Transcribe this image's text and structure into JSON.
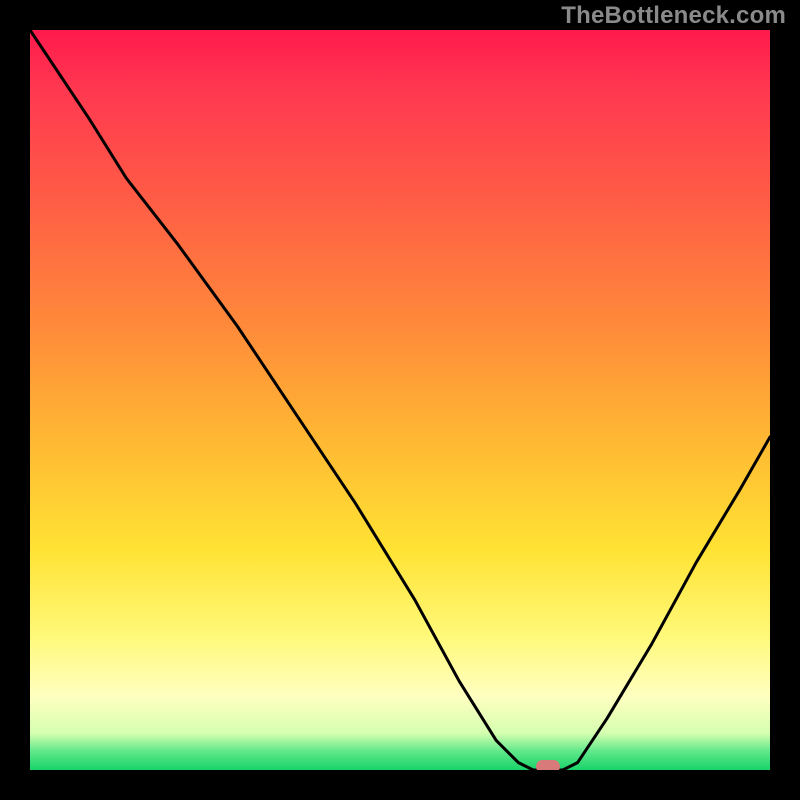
{
  "watermark": "TheBottleneck.com",
  "colors": {
    "frame": "#000000",
    "gradient_top": "#ff1a4d",
    "gradient_mid": "#ffe233",
    "gradient_bottom": "#19d36a",
    "curve": "#000000",
    "marker": "#d97a7a"
  },
  "chart_data": {
    "type": "line",
    "title": "",
    "xlabel": "",
    "ylabel": "",
    "xlim": [
      0,
      100
    ],
    "ylim": [
      0,
      100
    ],
    "annotations": [],
    "marker": {
      "x": 70,
      "y": 0
    },
    "series": [
      {
        "name": "bottleneck-curve",
        "x": [
          0,
          8,
          13,
          20,
          28,
          36,
          44,
          52,
          58,
          63,
          66,
          68,
          70,
          72,
          74,
          78,
          84,
          90,
          96,
          100
        ],
        "values": [
          100,
          88,
          80,
          71,
          60,
          48,
          36,
          23,
          12,
          4,
          1,
          0,
          0,
          0,
          1,
          7,
          17,
          28,
          38,
          45
        ]
      }
    ]
  }
}
